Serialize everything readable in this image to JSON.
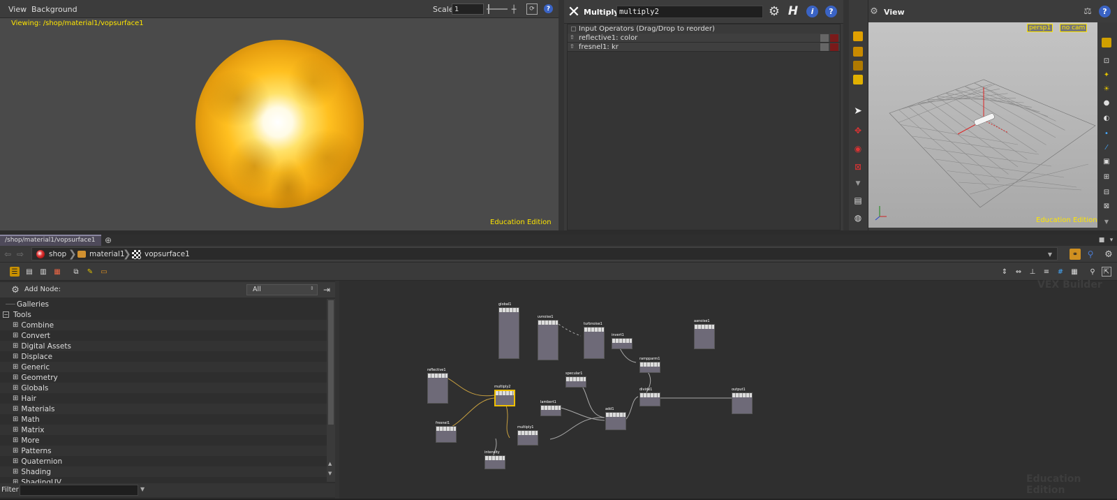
{
  "viewer": {
    "menu_view": "View",
    "menu_background": "Background",
    "scale_label": "Scale",
    "scale_value": "1",
    "viewing_text": "Viewing: /shop/material1/vopsurface1",
    "edition": "Education Edition"
  },
  "params": {
    "node_type": "Multiply",
    "node_name": "multiply2",
    "section_title": "Input Operators (Drag/Drop to reorder)",
    "inputs": [
      "reflective1: color",
      "fresnel1: kr"
    ]
  },
  "scene_view": {
    "title": "View",
    "camera_persp": "persp1",
    "camera_nocam": "no cam",
    "edition": "Education Edition"
  },
  "network": {
    "tab_label": "/shop/material1/vopsurface1",
    "path": [
      "shop",
      "material1",
      "vopsurface1"
    ],
    "add_node_label": "Add Node:",
    "filter_select": "All",
    "filter_label": "Filter",
    "watermark": "VEX Builder",
    "edition": "Education Edition",
    "tree": {
      "galleries": "Galleries",
      "tools": "Tools",
      "items": [
        "Combine",
        "Convert",
        "Digital Assets",
        "Displace",
        "Generic",
        "Geometry",
        "Globals",
        "Hair",
        "Materials",
        "Math",
        "Matrix",
        "More",
        "Patterns",
        "Quaternion",
        "Shading",
        "ShadingUV"
      ]
    },
    "nodes": {
      "global1": "global1",
      "uvnoise1": "uvnoise1",
      "turbnoise1": "turbnoise1",
      "invert1": "invert1",
      "aanoise1": "aanoise1",
      "rampparm1": "rampparm1",
      "reflective1": "reflective1",
      "multiply2": "multiply2",
      "specular1": "specular1",
      "lambert1": "lambert1",
      "add1": "add1",
      "divide1": "divide1",
      "output1": "output1",
      "fresnel1": "fresnel1",
      "multiply1": "multiply1",
      "intensity": "intensity"
    }
  },
  "colors": {
    "accent_yellow": "#ffe600",
    "bg_dark": "#2e2e2e",
    "panel": "#3d3d3d",
    "node_fill": "#6e6a78",
    "selected_node": "#f0c000"
  }
}
